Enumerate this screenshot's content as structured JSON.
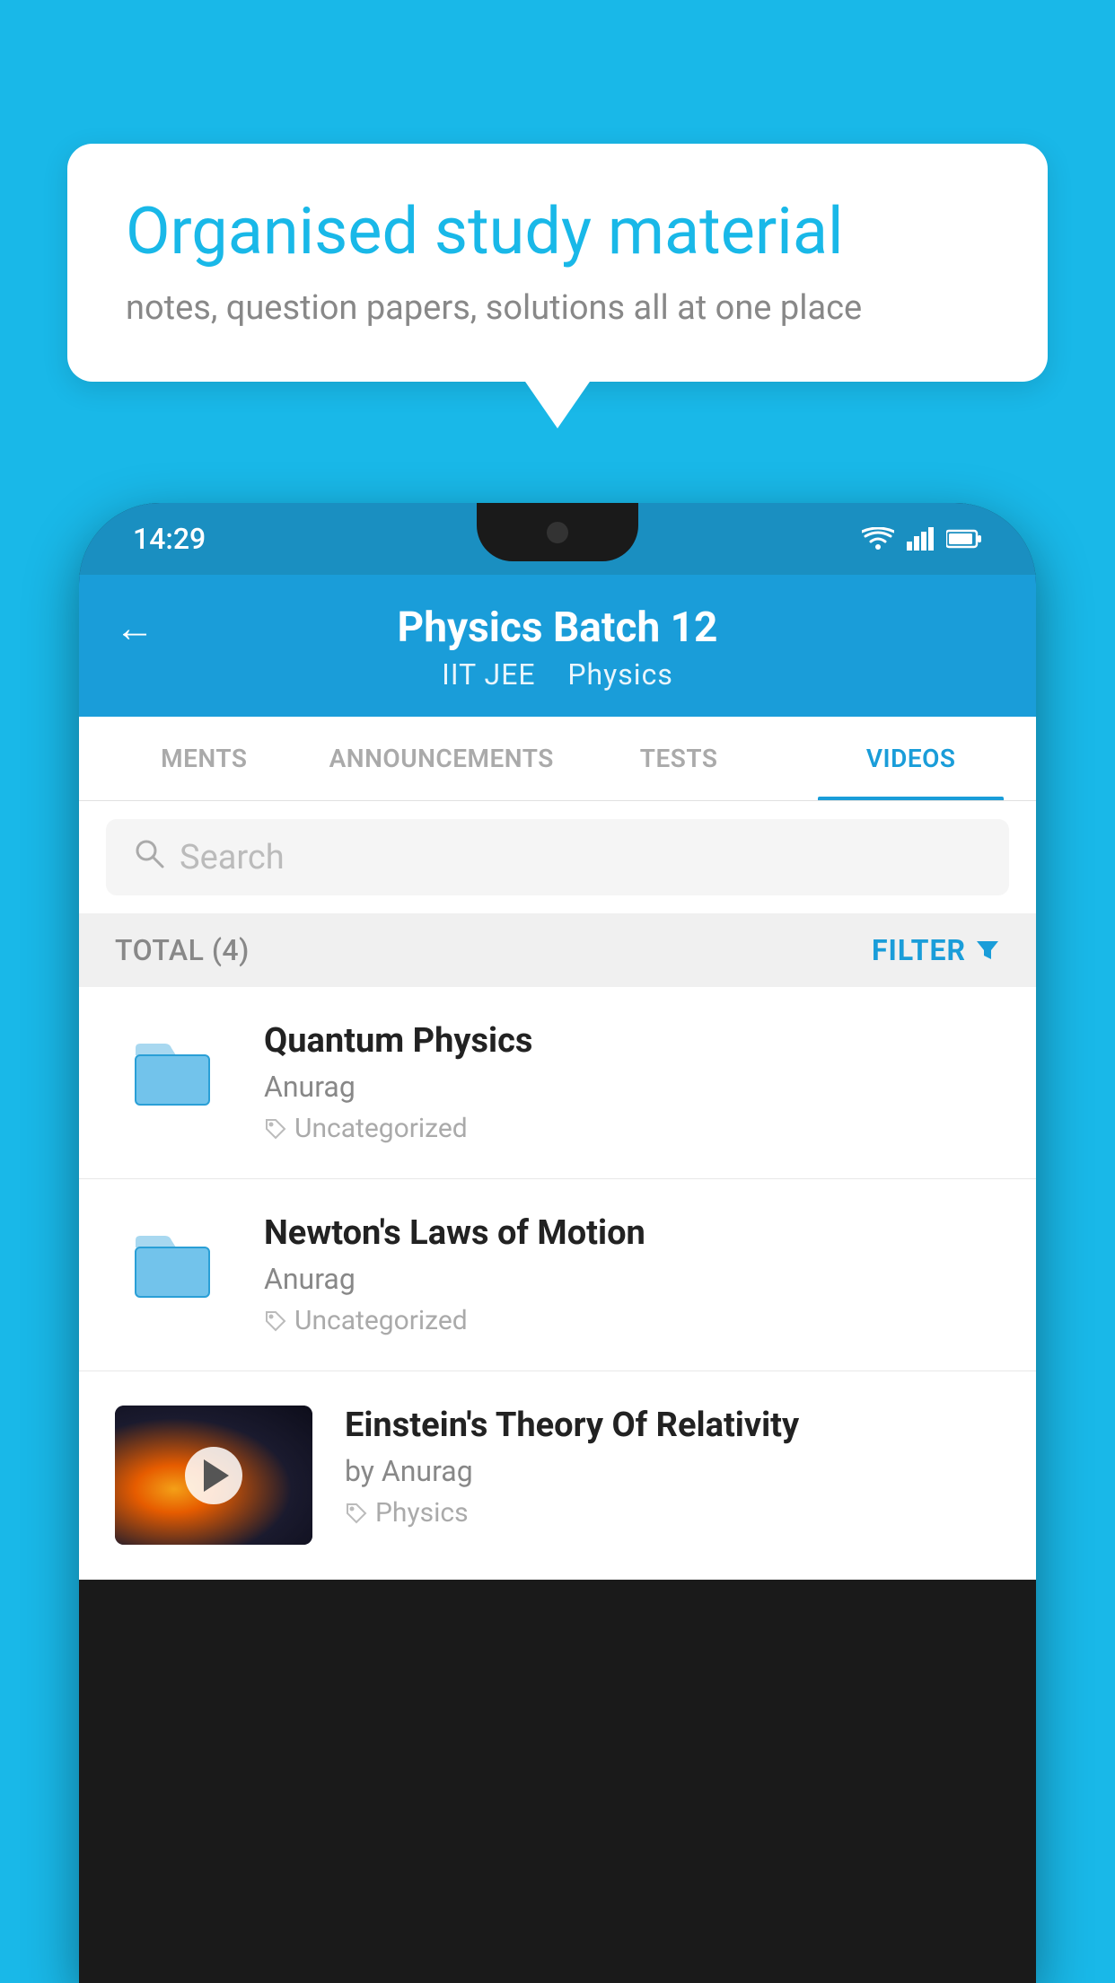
{
  "background_color": "#19b8e8",
  "bubble": {
    "title": "Organised study material",
    "subtitle": "notes, question papers, solutions all at one place"
  },
  "phone": {
    "status_bar": {
      "time": "14:29"
    },
    "header": {
      "title": "Physics Batch 12",
      "subtitle_parts": [
        "IIT JEE",
        "Physics"
      ],
      "back_label": "←"
    },
    "tabs": [
      {
        "label": "MENTS",
        "active": false
      },
      {
        "label": "ANNOUNCEMENTS",
        "active": false
      },
      {
        "label": "TESTS",
        "active": false
      },
      {
        "label": "VIDEOS",
        "active": true
      }
    ],
    "search": {
      "placeholder": "Search"
    },
    "filter_bar": {
      "total_label": "TOTAL (4)",
      "filter_label": "FILTER"
    },
    "videos": [
      {
        "id": 1,
        "title": "Quantum Physics",
        "author": "Anurag",
        "tag": "Uncategorized",
        "has_thumbnail": false
      },
      {
        "id": 2,
        "title": "Newton's Laws of Motion",
        "author": "Anurag",
        "tag": "Uncategorized",
        "has_thumbnail": false
      },
      {
        "id": 3,
        "title": "Einstein's Theory Of Relativity",
        "author": "by Anurag",
        "tag": "Physics",
        "has_thumbnail": true
      }
    ]
  }
}
